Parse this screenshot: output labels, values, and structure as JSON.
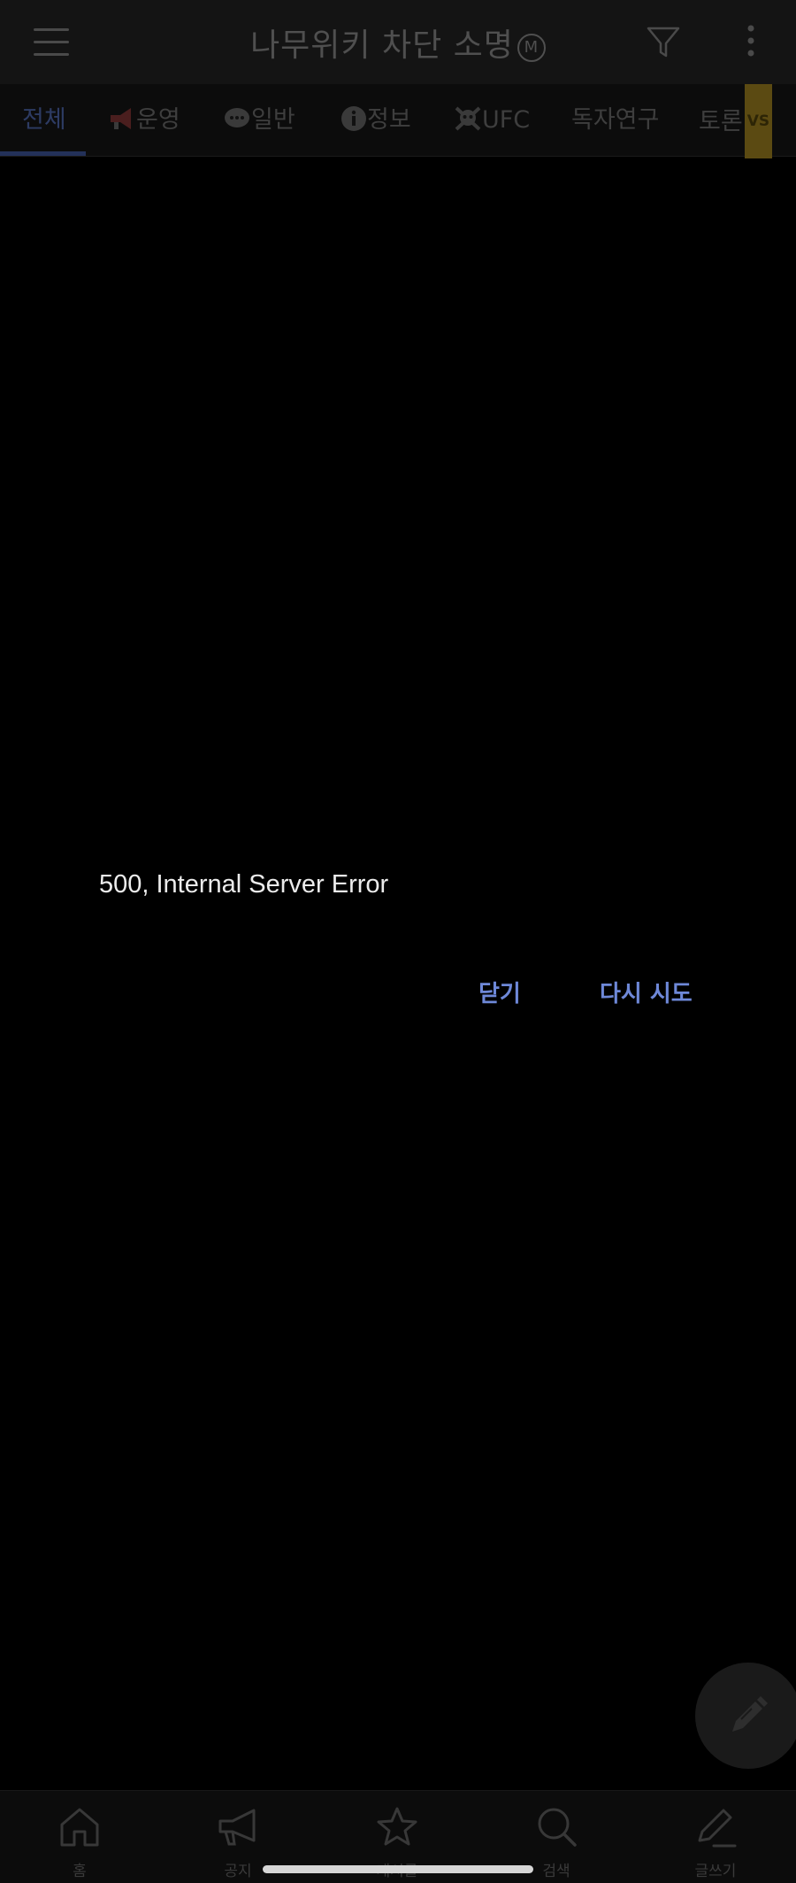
{
  "header": {
    "title": "나무위키 차단 소명",
    "badge": "M",
    "menu_icon": "hamburger-icon",
    "filter_icon": "filter-icon",
    "more_icon": "more-vertical-icon"
  },
  "tabs": [
    {
      "label": "전체",
      "active": true
    },
    {
      "label": "운영",
      "icon": "megaphone-icon"
    },
    {
      "label": "일반",
      "icon": "speech-bubble-icon"
    },
    {
      "label": "정보",
      "icon": "info-icon"
    },
    {
      "label": "UFC",
      "icon": "skull-icon"
    },
    {
      "label": "독자연구"
    },
    {
      "label": "토론",
      "badge": "VS"
    }
  ],
  "dialog": {
    "message": "500, Internal Server Error",
    "close_label": "닫기",
    "retry_label": "다시 시도"
  },
  "fab": {
    "icon": "pencil-icon"
  },
  "bottom_nav": [
    {
      "label": "홈",
      "icon": "home-icon"
    },
    {
      "label": "공지",
      "icon": "megaphone-icon"
    },
    {
      "label": "게시글",
      "icon": "star-icon"
    },
    {
      "label": "검색",
      "icon": "search-icon"
    },
    {
      "label": "글쓰기",
      "icon": "write-icon"
    }
  ],
  "colors": {
    "accent": "#6e88d8",
    "background": "#000000"
  }
}
